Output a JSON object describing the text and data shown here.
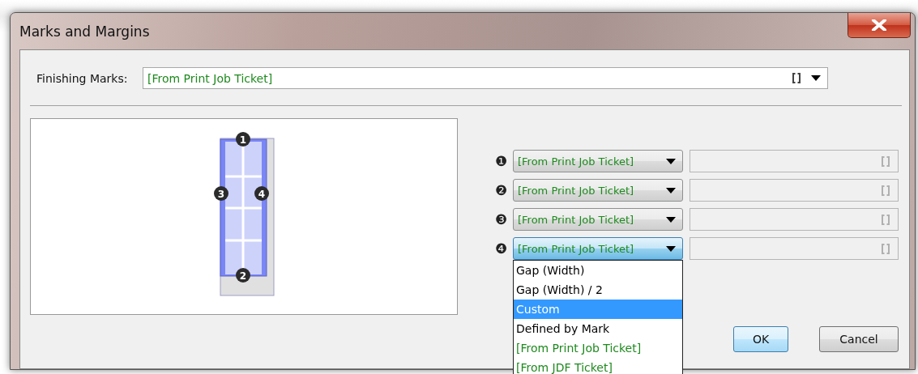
{
  "window": {
    "title": "Marks and Margins"
  },
  "finishing_marks": {
    "label": "Finishing Marks:",
    "value": "[From Print Job Ticket]"
  },
  "preview": {
    "badges": [
      "1",
      "2",
      "3",
      "4"
    ]
  },
  "margins": [
    {
      "number": "❶",
      "value": "[From Print Job Ticket]",
      "focused": false
    },
    {
      "number": "❷",
      "value": "[From Print Job Ticket]",
      "focused": false
    },
    {
      "number": "❸",
      "value": "[From Print Job Ticket]",
      "focused": false
    },
    {
      "number": "❹",
      "value": "[From Print Job Ticket]",
      "focused": true
    }
  ],
  "dropdown_list": {
    "items": [
      {
        "label": "Gap (Width)",
        "kind": "plain",
        "selected": false
      },
      {
        "label": "Gap (Width) / 2",
        "kind": "plain",
        "selected": false
      },
      {
        "label": "Custom",
        "kind": "plain",
        "selected": true
      },
      {
        "label": "Defined by Mark",
        "kind": "plain",
        "selected": false
      },
      {
        "label": "[From Print Job Ticket]",
        "kind": "ticket",
        "selected": false
      },
      {
        "label": "[From JDF Ticket]",
        "kind": "ticket",
        "selected": false
      }
    ]
  },
  "buttons": [
    {
      "label": "OK",
      "default": true
    },
    {
      "label": "Cancel",
      "default": false
    }
  ]
}
